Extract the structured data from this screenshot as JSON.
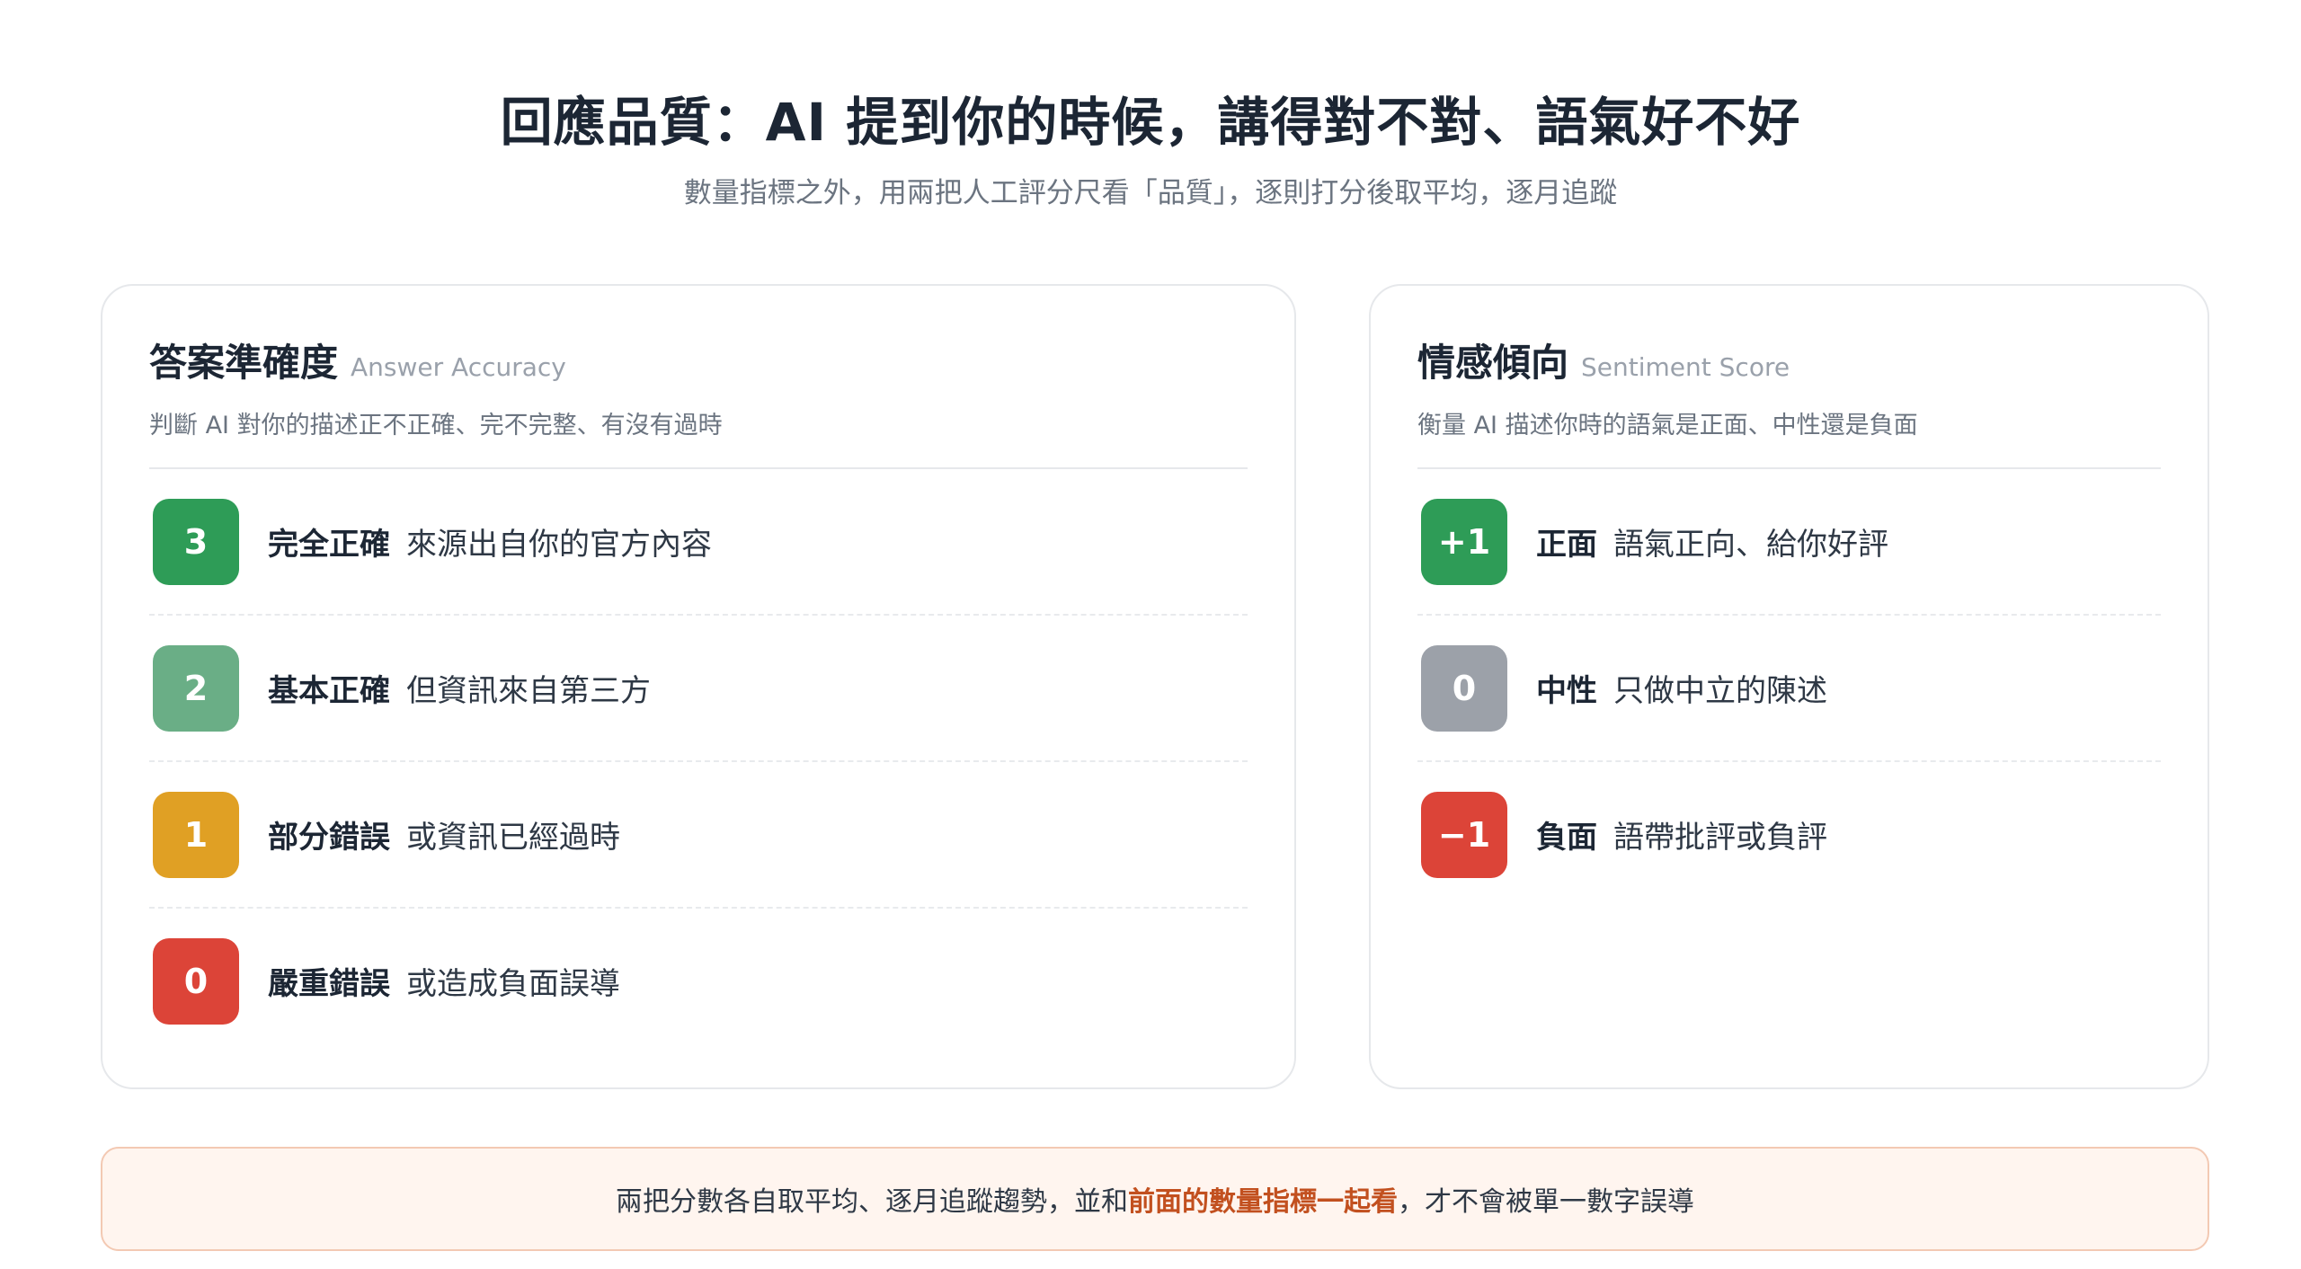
{
  "header": {
    "title": "回應品質：AI 提到你的時候，講得對不對、語氣好不好",
    "subtitle": "數量指標之外，用兩把人工評分尺看「品質」，逐則打分後取平均，逐月追蹤"
  },
  "accuracy_card": {
    "title": "答案準確度",
    "title_en": "Answer Accuracy",
    "description": "判斷 AI 對你的描述正不正確、完不完整、有沒有過時",
    "items": [
      {
        "score": "3",
        "label": "完全正確",
        "desc": "來源出自你的官方內容",
        "color": "#2e9c57"
      },
      {
        "score": "2",
        "label": "基本正確",
        "desc": "但資訊來自第三方",
        "color": "#6aae86"
      },
      {
        "score": "1",
        "label": "部分錯誤",
        "desc": "或資訊已經過時",
        "color": "#e0a024"
      },
      {
        "score": "0",
        "label": "嚴重錯誤",
        "desc": "或造成負面誤導",
        "color": "#dc4438"
      }
    ]
  },
  "sentiment_card": {
    "title": "情感傾向",
    "title_en": "Sentiment Score",
    "description": "衡量 AI 描述你時的語氣是正面、中性還是負面",
    "items": [
      {
        "score": "+1",
        "label": "正面",
        "desc": "語氣正向、給你好評",
        "color": "#2e9c57"
      },
      {
        "score": "0",
        "label": "中性",
        "desc": "只做中立的陳述",
        "color": "#9ca1a9"
      },
      {
        "score": "−1",
        "label": "負面",
        "desc": "語帶批評或負評",
        "color": "#dc4438"
      }
    ]
  },
  "footer": {
    "text_before": "兩把分數各自取平均、逐月追蹤趨勢，並和",
    "highlight": "前面的數量指標一起看",
    "text_after": "，才不會被單一數字誤導",
    "highlight_color": "#c2501f"
  }
}
